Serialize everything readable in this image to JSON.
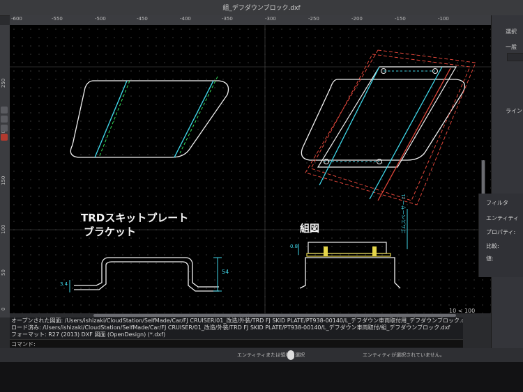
{
  "window": {
    "title": "組_デフダウンブロック.dxf"
  },
  "ruler": {
    "top_ticks": [
      "-600",
      "-550",
      "-500",
      "-450",
      "-400",
      "-350",
      "-300",
      "-250",
      "-200",
      "-150",
      "-100"
    ],
    "left_ticks": [
      "250",
      "200",
      "150",
      "100",
      "50",
      "0"
    ]
  },
  "drawing": {
    "label_left_line1": "TRDスキットプレート",
    "label_left_line2": "ブラケット",
    "label_right": "組図",
    "dim_54": "54",
    "dim_34": "3.4",
    "dim_08": "0.8",
    "dim_side_right": "ゴムスペーサー t1"
  },
  "canvas": {
    "zoom_label": "10 < 100"
  },
  "console": {
    "line1": "オープンされた図面: /Users/ishizaki/CloudStation/SelfMade/Car/FJ CRUISER/01_改造/外装/TRD FJ SKID PLATE/PT938-00140/L_デフダウン車両取付用_デフダウンブロック.dxf",
    "line2": "ロード済み: /Users/ishizaki/CloudStation/SelfMade/Car/FJ CRUISER/01_改造/外装/TRD FJ SKID PLATE/PT938-00140/L_デフダウン車両取付/組_デフダウンブロック.dxf",
    "line3": "フォーマット: R27 (2013) DXF 図面 (OpenDesign) (*.dxf)"
  },
  "command": {
    "label": "コマンド:"
  },
  "status": {
    "left": "エンティティまたは領域を選択",
    "right": "エンティティが選択されていません。"
  },
  "right_panel": {
    "select_label": "選択",
    "general_label": "一般",
    "line_label": "ライン"
  },
  "filter_panel": {
    "title": "フィルタ",
    "entity_label": "エンティティ",
    "property_label": "プロパティ:",
    "compare_label": "比較:",
    "value_label": "値:"
  },
  "colors": {
    "canvas_bg": "#000000",
    "cyan_line": "#3fd6e8",
    "green_dash": "#34e05c",
    "red_dash": "#e0463a",
    "yellow_part": "#e6d64a",
    "white_line": "#f0f0f0"
  }
}
